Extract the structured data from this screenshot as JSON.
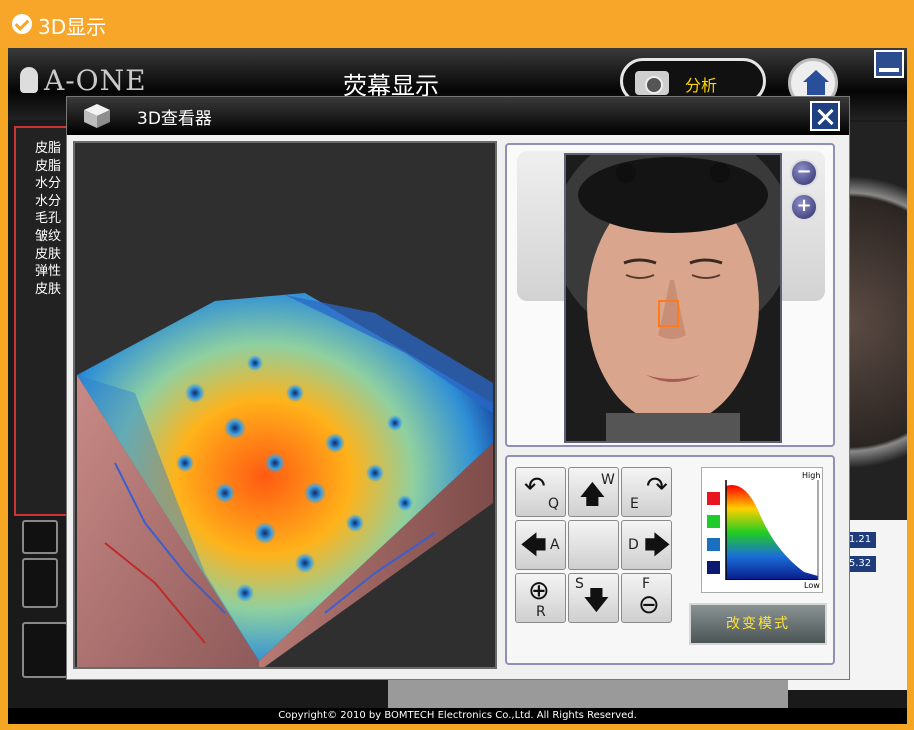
{
  "window": {
    "title": "3D显示"
  },
  "app": {
    "logo_text": "A-ONE",
    "screen_title": "荧幕显示",
    "analyze_label": "分析",
    "menu_items": [
      "皮脂",
      "皮脂",
      "水分",
      "水分",
      "毛孔",
      "皱纹",
      "皮肤",
      "弹性",
      "皮肤"
    ],
    "table_cells": [
      "1.21",
      "5.32"
    ],
    "footer_text": "Copyright© 2010 by BOMTECH Electronics Co.,Ltd. All Rights Reserved."
  },
  "dialog": {
    "title": "3D查看器",
    "controls": [
      {
        "name": "rotate-q",
        "letter": "Q",
        "arrow": "↶"
      },
      {
        "name": "move-up-w",
        "letter": "W",
        "arrow": "🡅"
      },
      {
        "name": "rotate-e",
        "letter": "E",
        "arrow": "↷"
      },
      {
        "name": "move-left-a",
        "letter": "A",
        "arrow": "🡄"
      },
      {
        "name": "center",
        "letter": "",
        "arrow": ""
      },
      {
        "name": "move-right-d",
        "letter": "D",
        "arrow": "🡆"
      },
      {
        "name": "zoom-in-r",
        "letter": "R",
        "arrow": "⊕"
      },
      {
        "name": "move-down-s",
        "letter": "S",
        "arrow": "🡇"
      },
      {
        "name": "zoom-out-f",
        "letter": "F",
        "arrow": "⊖"
      }
    ],
    "scale": {
      "high": "High",
      "low": "Low",
      "swatches": [
        "#e8141e",
        "#1ecb2c",
        "#1a6fbf",
        "#0b1a6e"
      ]
    },
    "mode_button": "改变模式",
    "zoom_out_symbol": "−",
    "zoom_in_symbol": "+"
  }
}
